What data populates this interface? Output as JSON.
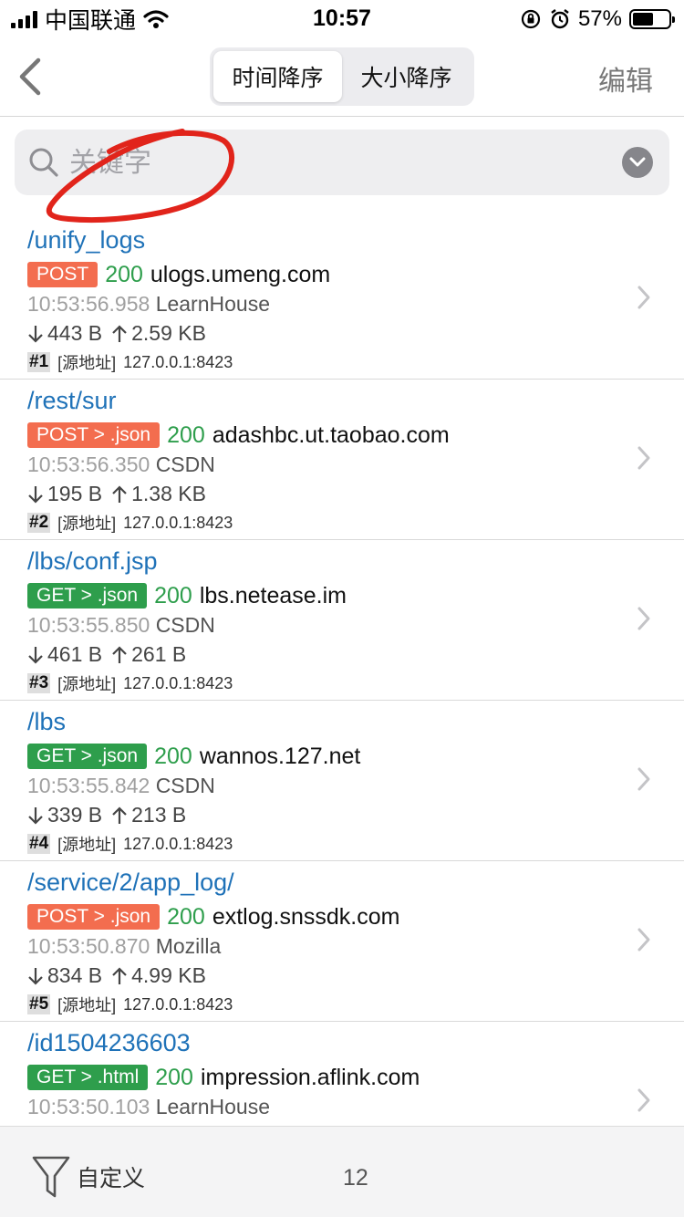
{
  "status_bar": {
    "carrier": "中国联通",
    "time": "10:57",
    "battery_percent": "57%",
    "battery_level": 0.57
  },
  "nav": {
    "segments": [
      "时间降序",
      "大小降序"
    ],
    "selected_segment": 0,
    "edit_label": "编辑"
  },
  "search": {
    "placeholder": "关键字",
    "value": ""
  },
  "requests": [
    {
      "path": "/unify_logs",
      "method": "POST",
      "method_color": "#f36d4f",
      "status": "200",
      "host": "ulogs.umeng.com",
      "time": "10:53:56.958",
      "client": "LearnHouse",
      "down": "443 B",
      "up": "2.59 KB",
      "index": "#1",
      "source_label": "[源地址]",
      "source": "127.0.0.1:8423"
    },
    {
      "path": "/rest/sur",
      "method": "POST > .json",
      "method_color": "#f36d4f",
      "status": "200",
      "host": "adashbc.ut.taobao.com",
      "time": "10:53:56.350",
      "client": "CSDN",
      "down": "195 B",
      "up": "1.38 KB",
      "index": "#2",
      "source_label": "[源地址]",
      "source": "127.0.0.1:8423"
    },
    {
      "path": "/lbs/conf.jsp",
      "method": "GET > .json",
      "method_color": "#2e9e4c",
      "status": "200",
      "host": "lbs.netease.im",
      "time": "10:53:55.850",
      "client": "CSDN",
      "down": "461 B",
      "up": "261 B",
      "index": "#3",
      "source_label": "[源地址]",
      "source": "127.0.0.1:8423"
    },
    {
      "path": "/lbs",
      "method": "GET > .json",
      "method_color": "#2e9e4c",
      "status": "200",
      "host": "wannos.127.net",
      "time": "10:53:55.842",
      "client": "CSDN",
      "down": "339 B",
      "up": "213 B",
      "index": "#4",
      "source_label": "[源地址]",
      "source": "127.0.0.1:8423"
    },
    {
      "path": "/service/2/app_log/",
      "method": "POST > .json",
      "method_color": "#f36d4f",
      "status": "200",
      "host": "extlog.snssdk.com",
      "time": "10:53:50.870",
      "client": "Mozilla",
      "down": "834 B",
      "up": "4.99 KB",
      "index": "#5",
      "source_label": "[源地址]",
      "source": "127.0.0.1:8423"
    },
    {
      "path": "/id1504236603",
      "method": "GET > .html",
      "method_color": "#2e9e4c",
      "status": "200",
      "host": "impression.aflink.com",
      "time": "10:53:50.103",
      "client": "LearnHouse",
      "down": "",
      "up": "",
      "index": "",
      "source_label": "",
      "source": ""
    }
  ],
  "bottom_bar": {
    "filter_label": "自定义",
    "count": "12"
  },
  "colors": {
    "link_blue": "#1f72b8",
    "post": "#f36d4f",
    "get": "#2e9e4c",
    "annotation_red": "#e1241b"
  }
}
